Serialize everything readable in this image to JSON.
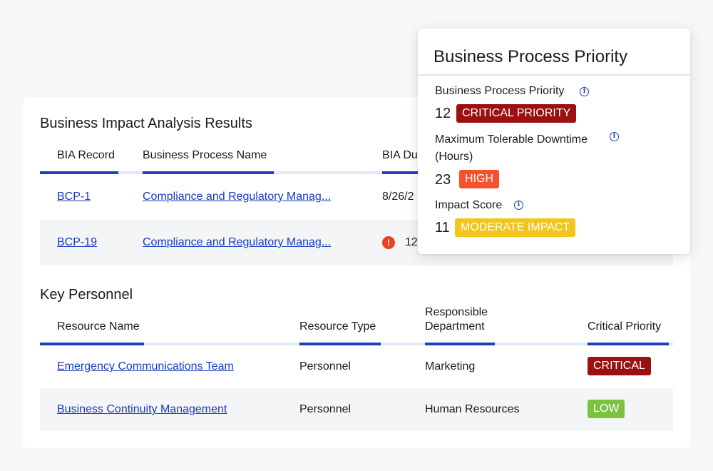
{
  "bia": {
    "title": "Business Impact Analysis Results",
    "columns": [
      "BIA Record",
      "Business Process Name",
      "BIA Du"
    ],
    "rows": [
      {
        "record": "BCP-1",
        "process": "Compliance and Regulatory Manag...",
        "due": "8/26/2"
      },
      {
        "record": "BCP-19",
        "process": "Compliance and Regulatory Manag...",
        "due": "12",
        "error_icon": "!"
      }
    ]
  },
  "personnel": {
    "title": "Key Personnel",
    "columns": [
      "Resource Name",
      "Resource Type",
      "Responsible Department",
      "Critical Priority"
    ],
    "rows": [
      {
        "name": "Emergency Communications Team",
        "type": "Personnel",
        "department": "Marketing",
        "priority": "CRITICAL",
        "priority_color": "#9b1010"
      },
      {
        "name": "Business Continuity Management",
        "type": "Personnel",
        "department": "Human Resources",
        "priority": "LOW",
        "priority_color": "#7dc23f"
      }
    ]
  },
  "popover": {
    "title": "Business Process Priority",
    "items": [
      {
        "label": "Business Process Priority",
        "value": "12",
        "badge": "CRITICAL PRIORITY",
        "badge_color": "#9b1010"
      },
      {
        "label_line1": "Maximum Tolerable Downtime",
        "label_line2": "(Hours)",
        "value": "23",
        "badge": "HIGH",
        "badge_color": "#f4512c"
      },
      {
        "label": "Impact Score",
        "value": "11",
        "badge": "MODERATE IMPACT",
        "badge_color": "#f2c51d"
      }
    ],
    "info_glyph": "i"
  },
  "colors": {
    "accent": "#1f3fbf",
    "link": "#1a3bbf",
    "error": "#e8431e"
  }
}
